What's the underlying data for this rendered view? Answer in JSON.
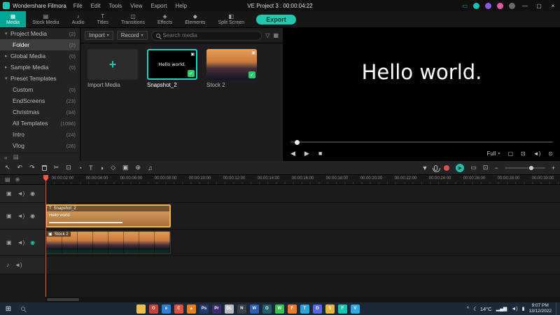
{
  "titlebar": {
    "app_name": "Wondershare Filmora",
    "menus": [
      "File",
      "Edit",
      "Tools",
      "View",
      "Export",
      "Help"
    ],
    "project_title": "VE Project 3 : 00:00:04:22",
    "window": {
      "minimize": "—",
      "maximize": "▢",
      "close": "×"
    }
  },
  "tabbar": {
    "tabs": [
      {
        "label": "Media",
        "icon": "▦"
      },
      {
        "label": "Stock Media",
        "icon": "▤"
      },
      {
        "label": "Audio",
        "icon": "♪"
      },
      {
        "label": "Titles",
        "icon": "T"
      },
      {
        "label": "Transitions",
        "icon": "◫"
      },
      {
        "label": "Effects",
        "icon": "◈"
      },
      {
        "label": "Elements",
        "icon": "◆"
      },
      {
        "label": "Split Screen",
        "icon": "◧"
      }
    ],
    "export_label": "Export"
  },
  "sidebar": {
    "items": [
      {
        "label": "Project Media",
        "count": "(2)",
        "arrow": "▾"
      },
      {
        "label": "Folder",
        "count": "(2)",
        "arrow": ""
      },
      {
        "label": "Global Media",
        "count": "(0)",
        "arrow": "▸"
      },
      {
        "label": "Sample Media",
        "count": "(0)",
        "arrow": "▸"
      },
      {
        "label": "Preset Templates",
        "count": "",
        "arrow": "▾"
      },
      {
        "label": "Custom",
        "count": "(0)",
        "arrow": ""
      },
      {
        "label": "EndScreens",
        "count": "(23)",
        "arrow": ""
      },
      {
        "label": "Christmas",
        "count": "(34)",
        "arrow": ""
      },
      {
        "label": "All Templates",
        "count": "(1086)",
        "arrow": ""
      },
      {
        "label": "Intro",
        "count": "(24)",
        "arrow": ""
      },
      {
        "label": "Vlog",
        "count": "(26)",
        "arrow": ""
      }
    ],
    "collapse_icon": "«"
  },
  "media": {
    "import_label": "Import",
    "record_label": "Record",
    "search_placeholder": "Search media",
    "items": [
      {
        "caption": "Import Media",
        "plus": "+"
      },
      {
        "caption": "Snapshot_2",
        "thumb_text": "Hello world.",
        "check": "✓"
      },
      {
        "caption": "Stock 2",
        "check": "✓"
      }
    ]
  },
  "preview": {
    "text": "Hello world.",
    "zoom_label": "Full"
  },
  "timeline": {
    "ruler": [
      "00:00:02:00",
      "00:00:04:00",
      "00:00:06:00",
      "00:00:08:00",
      "00:00:10:00",
      "00:00:12:00",
      "00:00:14:00",
      "00:00:16:00",
      "00:00:18:00",
      "00:00:20:00",
      "00:00:22:00",
      "00:00:24:00",
      "00:00:26:00",
      "00:00:28:00",
      "00:00:30:00"
    ],
    "title_clip": {
      "name": "Snapshot_2",
      "text": "Hello world"
    },
    "video_clip": {
      "name": "Stock 2"
    }
  },
  "taskbar": {
    "weather": "14°C",
    "time": "9:07 PM",
    "date": "13/12/2022",
    "apps": [
      {
        "name": "file-explorer",
        "color": "#e9c04f",
        "glyph": ""
      },
      {
        "name": "browser-red",
        "color": "#c7423a",
        "glyph": "O"
      },
      {
        "name": "edge",
        "color": "#2f7fd4",
        "glyph": "e"
      },
      {
        "name": "chrome",
        "color": "#dd5144",
        "glyph": "C"
      },
      {
        "name": "vlc",
        "color": "#e87f1e",
        "glyph": "▲"
      },
      {
        "name": "photoshop",
        "color": "#20376e",
        "glyph": "Ps"
      },
      {
        "name": "premiere",
        "color": "#3b2a6e",
        "glyph": "Pr"
      },
      {
        "name": "app-dl",
        "color": "#b8bec4",
        "glyph": "DL"
      },
      {
        "name": "notepad",
        "color": "#3a3f45",
        "glyph": "N"
      },
      {
        "name": "word",
        "color": "#2b5fb4",
        "glyph": "W"
      },
      {
        "name": "obs",
        "color": "#20606a",
        "glyph": "O"
      },
      {
        "name": "whatsapp",
        "color": "#37c24f",
        "glyph": "W"
      },
      {
        "name": "firefox",
        "color": "#ef7b2a",
        "glyph": "F"
      },
      {
        "name": "telegram",
        "color": "#2ba3d8",
        "glyph": "T"
      },
      {
        "name": "discord",
        "color": "#5a66e8",
        "glyph": "D"
      },
      {
        "name": "spotify",
        "color": "#e8b73a",
        "glyph": "S"
      },
      {
        "name": "filmora",
        "color": "#17c3ae",
        "glyph": "F"
      },
      {
        "name": "vscode",
        "color": "#2fa8e0",
        "glyph": "V"
      }
    ]
  }
}
